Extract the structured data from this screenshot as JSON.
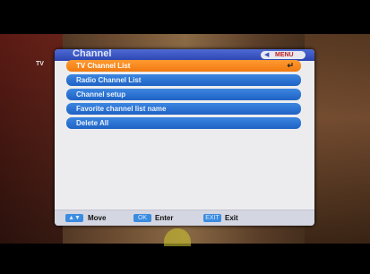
{
  "tag": "TV",
  "menu": {
    "title": "Channel",
    "badge_text": "MENU",
    "items": [
      {
        "label": "TV Channel List",
        "selected": true
      },
      {
        "label": "Radio Channel List",
        "selected": false
      },
      {
        "label": "Channel setup",
        "selected": false
      },
      {
        "label": "Favorite channel list name",
        "selected": false
      },
      {
        "label": "Delete All",
        "selected": false
      }
    ],
    "enter_icon": "↵"
  },
  "footer": {
    "move_label": "Move",
    "enter_label": "Enter",
    "exit_label": "Exit"
  },
  "colors": {
    "title_bar": "#2c45b0",
    "item_blue": "#1f62c4",
    "item_selected": "#f07a10",
    "panel_bg": "#ececef"
  }
}
